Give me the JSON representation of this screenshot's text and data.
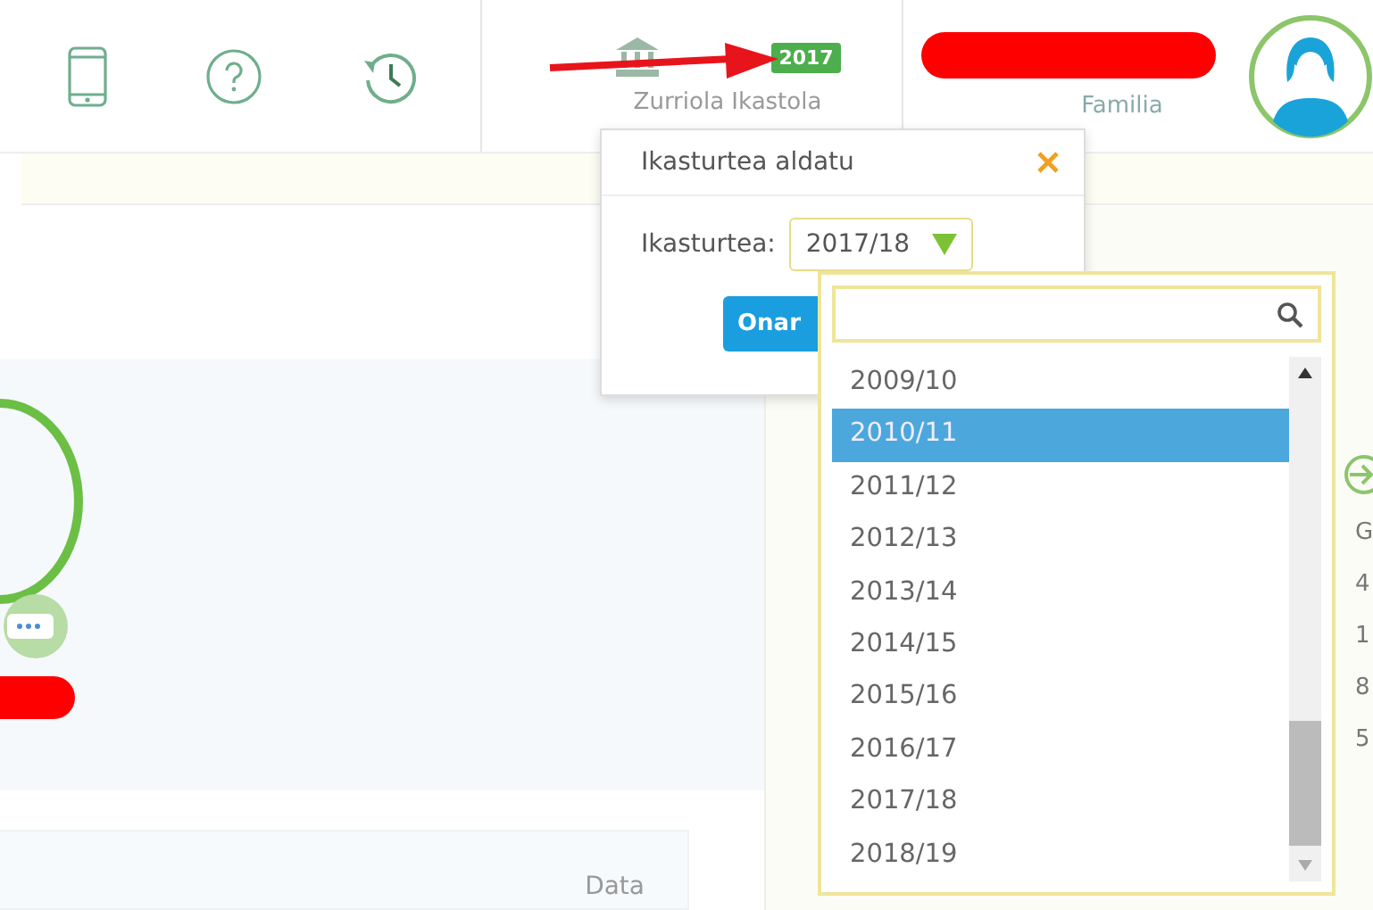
{
  "header": {
    "school": {
      "name": "Zurriola Ikastola",
      "year_badge": "2017"
    },
    "user": {
      "role": "Familia"
    }
  },
  "popover": {
    "title": "Ikasturtea aldatu",
    "field_label": "Ikasturtea:",
    "selected_value": "2017/18",
    "confirm_button": "Onar"
  },
  "dropdown": {
    "options": [
      {
        "label": "2009/10",
        "selected": false
      },
      {
        "label": "2010/11",
        "selected": true
      },
      {
        "label": "2011/12",
        "selected": false
      },
      {
        "label": "2012/13",
        "selected": false
      },
      {
        "label": "2013/14",
        "selected": false
      },
      {
        "label": "2014/15",
        "selected": false
      },
      {
        "label": "2015/16",
        "selected": false
      },
      {
        "label": "2016/17",
        "selected": false
      },
      {
        "label": "2017/18",
        "selected": false
      },
      {
        "label": "2018/19",
        "selected": false
      }
    ]
  },
  "table": {
    "column_header": "Data"
  },
  "side_column": {
    "texts": [
      "G",
      "4",
      "1",
      "8",
      "5"
    ]
  }
}
